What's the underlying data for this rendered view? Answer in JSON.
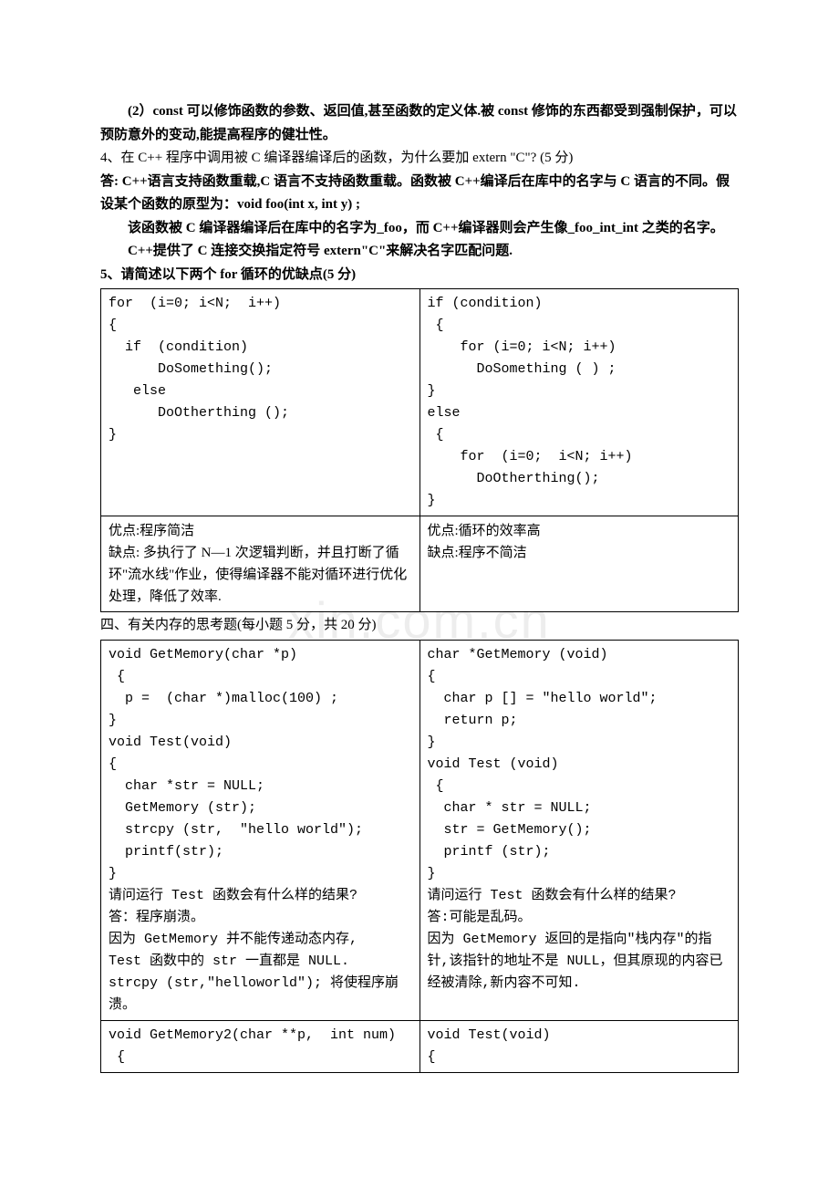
{
  "watermark": "xin.com.cn",
  "p1": "(2）const 可以修饰函数的参数、返回值,甚至函数的定义体.被 const 修饰的东西都受到强制保护，可以预防意外的变动,能提高程序的健壮性。",
  "p2a": "4、在 C++ 程序中调用被 C 编译器编译后的函数，为什么要加 extern \"C\"? (5 分)",
  "p3": "答: C++语言支持函数重载,C 语言不支持函数重载。函数被 C++编译后在库中的名字与 C 语言的不同。假设某个函数的原型为：void foo(int x, int y) ;",
  "p4": "该函数被 C 编译器编译后在库中的名字为_foo，而 C++编译器则会产生像_foo_int_int 之类的名字。",
  "p5": "C++提供了 C 连接交换指定符号 extern\"C\"来解决名字匹配问题.",
  "p6": "5、请简述以下两个 for 循环的优缺点(5 分)",
  "table1": {
    "r1c1": "for  (i=0; i<N;  i++)\n{\n  if  (condition)\n      DoSomething();\n   else\n      DoOtherthing ();\n}",
    "r1c2": "if (condition)\n {\n    for (i=0; i<N; i++)\n      DoSomething ( ) ;\n}\nelse\n {\n    for  (i=0;  i<N; i++)\n      DoOtherthing();\n}",
    "r2c1": "优点:程序简洁\n缺点: 多执行了 N—1 次逻辑判断，并且打断了循环\"流水线\"作业，使得编译器不能对循环进行优化处理，降低了效率.",
    "r2c2": "优点:循环的效率高\n缺点:程序不简洁"
  },
  "p7": "四、有关内存的思考题(每小题 5 分，共 20 分)",
  "table2": {
    "r1c1": "void GetMemory(char *p)\n {\n  p =  (char *)malloc(100) ;\n}\nvoid Test(void)\n{\n  char *str = NULL;\n  GetMemory (str);\n  strcpy (str,  \"hello world\");\n  printf(str);\n}\n请问运行 Test 函数会有什么样的结果?\n答：程序崩溃。\n因为 GetMemory 并不能传递动态内存,\nTest 函数中的 str 一直都是 NULL.\nstrcpy (str,\"helloworld\"); 将使程序崩溃。\n",
    "r1c2": "char *GetMemory (void)\n{\n  char p [] = \"hello world\";\n  return p;\n}\nvoid Test (void)\n {\n  char * str = NULL;\n  str = GetMemory();\n  printf (str);\n}\n请问运行 Test 函数会有什么样的结果?\n答:可能是乱码。\n因为 GetMemory 返回的是指向\"栈内存\"的指针,该指针的地址不是 NULL，但其原现的内容已经被清除,新内容不可知.",
    "r2c1": "void GetMemory2(char **p,  int num)\n {",
    "r2c2": "void Test(void)\n{"
  }
}
